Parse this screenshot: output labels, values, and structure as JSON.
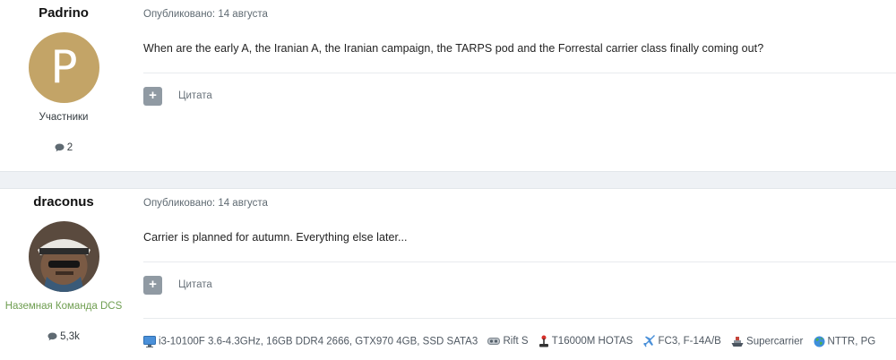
{
  "posts": [
    {
      "author": "Padrino",
      "avatar_letter": "P",
      "avatar_color": "#c3a467",
      "rank": "Участники",
      "post_count": "2",
      "published": "Опубликовано: 14 августа",
      "body": "When are the early A, the Iranian A, the Iranian campaign, the TARPS pod and the Forrestal carrier class finally coming out?",
      "multiquote_icon": "plus-icon",
      "quote_label": "Цитата"
    },
    {
      "author": "draconus",
      "avatar_icon": "avatar-photo",
      "rank": "Наземная Команда DCS",
      "rank_color": "#6f9e51",
      "post_count": "5,3k",
      "published": "Опубликовано: 14 августа",
      "body": "Carrier is planned for autumn. Everything else later...",
      "multiquote_icon": "plus-icon",
      "quote_label": "Цитата",
      "signature": [
        {
          "icon": "monitor-icon",
          "text": "i3-10100F 3.6-4.3GHz, 16GB DDR4 2666, GTX970 4GB, SSD SATA3"
        },
        {
          "icon": "vr-headset-icon",
          "text": "Rift S"
        },
        {
          "icon": "joystick-icon",
          "text": "T16000M HOTAS"
        },
        {
          "icon": "jet-icon",
          "text": "FC3, F-14A/B"
        },
        {
          "icon": "ship-icon",
          "text": "Supercarrier"
        },
        {
          "icon": "globe-icon",
          "text": "NTTR, PG"
        }
      ]
    }
  ]
}
